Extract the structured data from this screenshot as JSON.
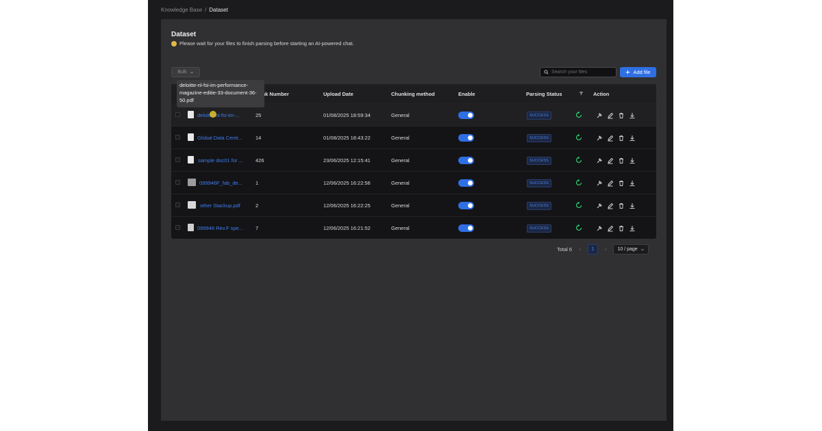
{
  "breadcrumb": {
    "root": "Knowledge Base",
    "sep": "/",
    "current": "Dataset"
  },
  "page": {
    "title": "Dataset",
    "subtitle": "Please wait for your files to finish parsing before starting an AI-powered chat."
  },
  "toolbar": {
    "bulk_label": "Bulk",
    "search_placeholder": "Search your files",
    "add_label": "Add file"
  },
  "table": {
    "headers": {
      "chunk": "Chunk Number",
      "upload": "Upload Date",
      "method": "Chunking method",
      "enable": "Enable",
      "status": "Parsing Status",
      "action": "Action"
    },
    "rows": [
      {
        "name": "deloitte-nl-fsi-im-...",
        "chunks": "25",
        "date": "01/08/2025 18:59:34",
        "method": "General",
        "enabled": true,
        "status": "SUCCESS"
      },
      {
        "name": "Global Data Centr...",
        "chunks": "14",
        "date": "01/08/2025 18:43:22",
        "method": "General",
        "enabled": true,
        "status": "SUCCESS"
      },
      {
        "name": "sample doc01 for ...",
        "chunks": "426",
        "date": "23/06/2025 12:15:41",
        "method": "General",
        "enabled": true,
        "status": "SUCCESS"
      },
      {
        "name": "099946F_fab_de...",
        "chunks": "1",
        "date": "12/06/2025 16:22:56",
        "method": "General",
        "enabled": true,
        "status": "SUCCESS"
      },
      {
        "name": "other Stackup.pdf",
        "chunks": "2",
        "date": "12/06/2025 16:22:25",
        "method": "General",
        "enabled": true,
        "status": "SUCCESS"
      },
      {
        "name": "099946 Rev.F spe...",
        "chunks": "7",
        "date": "12/06/2025 16:21:52",
        "method": "General",
        "enabled": true,
        "status": "SUCCESS"
      }
    ]
  },
  "tooltip": {
    "text": "deloitte-nl-fsi-im-performance-magazine-editie-33-document-36-50.pdf"
  },
  "pagination": {
    "total_label": "Total 6",
    "current_page": "1",
    "page_size": "10 / page"
  },
  "colors": {
    "accent": "#2f6fe4",
    "link": "#3f7df0",
    "success": "#4a86f0",
    "reparse": "#2ecc71"
  }
}
